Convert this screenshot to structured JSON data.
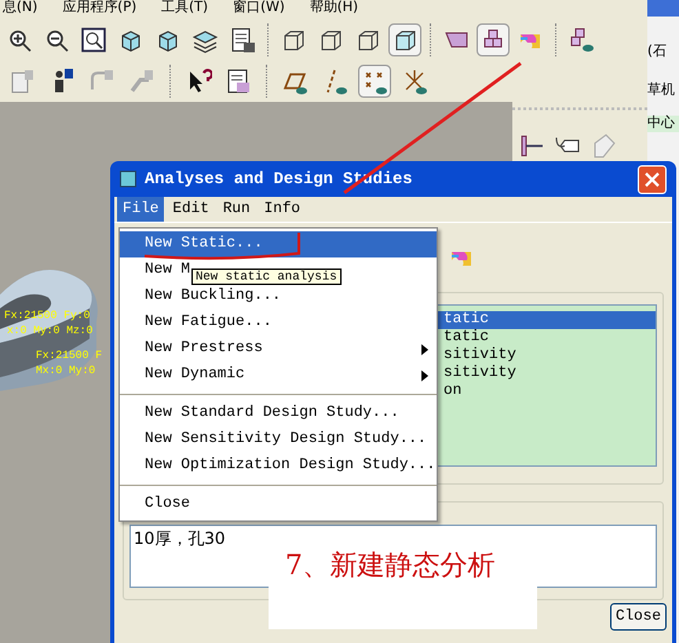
{
  "menu_bar": [
    {
      "label": "息(N)"
    },
    {
      "label": "应用程序(P)"
    },
    {
      "label": "工具(T)"
    },
    {
      "label": "窗口(W)"
    },
    {
      "label": "帮助(H)"
    }
  ],
  "side_strip": [
    {
      "label": "(石"
    },
    {
      "label": "草机"
    },
    {
      "label": "中心"
    }
  ],
  "model_labels": [
    "Fx:21500 Fy:0",
    "x:0 My:0 Mz:0",
    "Fx:21500 F",
    "Mx:0 My:0"
  ],
  "dialog": {
    "title": "Analyses and Design Studies",
    "menus": [
      {
        "label": "File",
        "selected": true
      },
      {
        "label": "Edit",
        "selected": false
      },
      {
        "label": "Run",
        "selected": false
      },
      {
        "label": "Info",
        "selected": false
      }
    ],
    "dropdown": [
      {
        "kind": "item",
        "label": "New Static...",
        "selected": true,
        "submenu": false
      },
      {
        "kind": "item",
        "label": "New M",
        "selected": false,
        "submenu": false
      },
      {
        "kind": "item",
        "label": "New Buckling...",
        "selected": false,
        "submenu": false
      },
      {
        "kind": "item",
        "label": "New Fatigue...",
        "selected": false,
        "submenu": false
      },
      {
        "kind": "item",
        "label": "New Prestress",
        "selected": false,
        "submenu": true
      },
      {
        "kind": "item",
        "label": "New Dynamic",
        "selected": false,
        "submenu": true
      },
      {
        "kind": "separator"
      },
      {
        "kind": "item",
        "label": "New Standard Design Study...",
        "selected": false,
        "submenu": false
      },
      {
        "kind": "item",
        "label": "New Sensitivity Design Study...",
        "selected": false,
        "submenu": false
      },
      {
        "kind": "item",
        "label": "New Optimization Design Study...",
        "selected": false,
        "submenu": false
      },
      {
        "kind": "separator"
      },
      {
        "kind": "item",
        "label": "Close",
        "selected": false,
        "submenu": false
      }
    ],
    "tooltip": "New static analysis",
    "studies": [
      {
        "label": "tatic",
        "selected": true
      },
      {
        "label": "tatic",
        "selected": false
      },
      {
        "label": "sitivity",
        "selected": false
      },
      {
        "label": "sitivity",
        "selected": false
      },
      {
        "label": "on",
        "selected": false
      }
    ],
    "description": "10厚，孔30",
    "close_button": "Close"
  },
  "annotation": "7、新建静态分析"
}
